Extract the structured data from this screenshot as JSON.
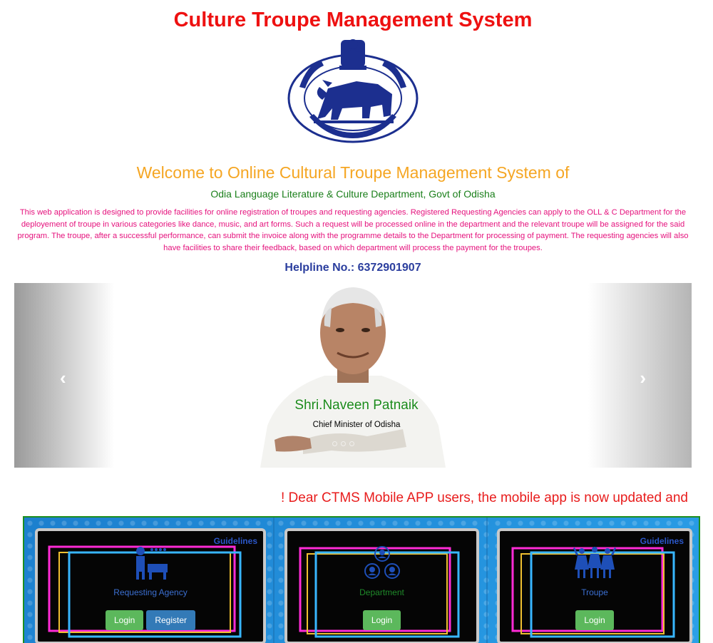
{
  "header": {
    "title": "Culture Troupe Management System",
    "welcome": "Welcome to Online Cultural Troupe Management System of",
    "department": "Odia Language Literature & Culture Department, Govt of Odisha",
    "description": "This web application is designed to provide facilities for online registration of troupes and requesting agencies. Registered Requesting Agencies can apply to the OLL & C Department for the deployement of troupe in various categories like dance, music, and art forms. Such a request will be processed online in the department and the relevant troupe will be assigned for the said program. The troupe, after a successful performance, can submit the invoice along with the programme details to the Department for processing of payment. The requesting agencies will also have facilities to share their feedback, based on which department will process the payment for the troupes.",
    "helpline": "Helpline No.: 6372901907",
    "emblem_icon": "odisha-emblem"
  },
  "carousel": {
    "caption_name": "Shri.Naveen Patnaik",
    "caption_role": "Chief Minister of Odisha",
    "prev_icon": "chevron-left-icon",
    "next_icon": "chevron-right-icon",
    "prev_glyph": "‹",
    "next_glyph": "›",
    "slide_count": 3
  },
  "notice": {
    "text": "! Dear CTMS Mobile APP users, the mobile app is now updated and"
  },
  "login_cards": [
    {
      "label": "Requesting Agency",
      "guidelines": "Guidelines",
      "login_label": "Login",
      "register_label": "Register",
      "label_color": "#3b6fd1",
      "icon": "agency-icon"
    },
    {
      "label": "Department",
      "guidelines": "",
      "login_label": "Login",
      "label_color": "#1f8a2a",
      "icon": "department-icon"
    },
    {
      "label": "Troupe",
      "guidelines": "Guidelines",
      "login_label": "Login",
      "label_color": "#3b6fd1",
      "icon": "troupe-icon"
    }
  ],
  "colors": {
    "title": "#ee1111",
    "welcome": "#f5a623",
    "department": "#1a7f1a",
    "description": "#e5127d",
    "helpline": "#2b3e9e",
    "notice": "#e81c1c",
    "panel_border": "#1e8e1e",
    "button_green": "#5cb85c",
    "button_blue": "#337ab7"
  }
}
